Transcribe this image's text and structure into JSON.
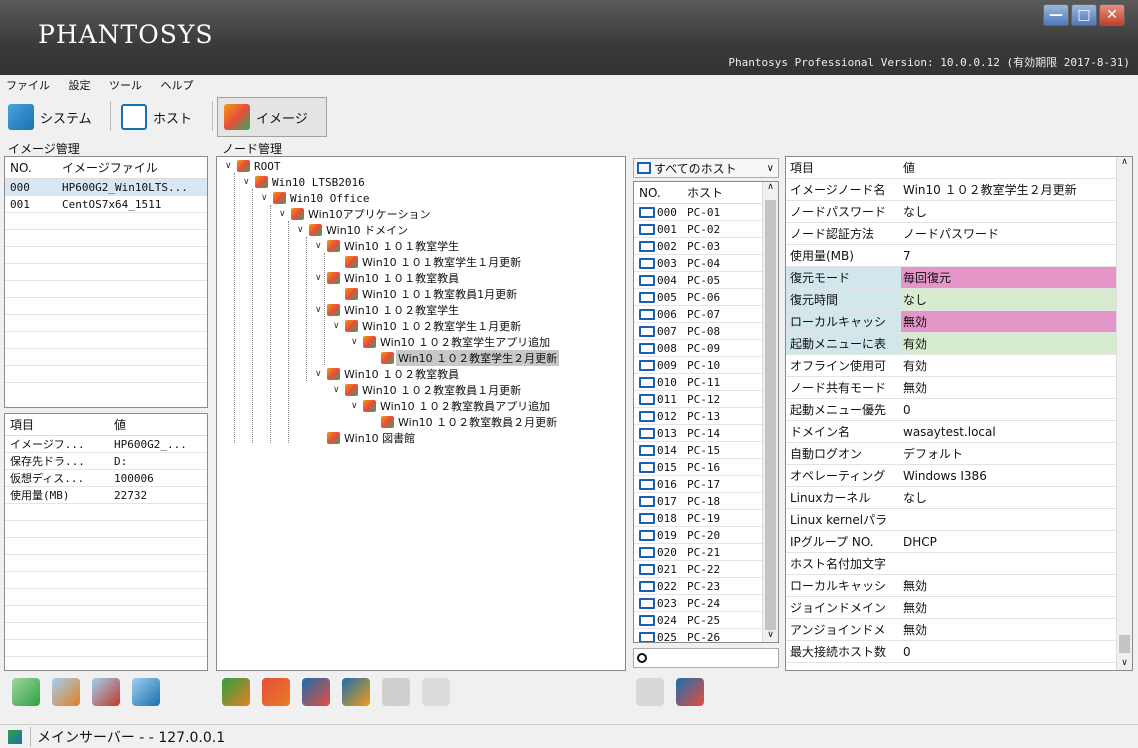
{
  "app": {
    "logo": "PHANTOSYS",
    "version": "Phantosys Professional Version: 10.0.0.12 (有効期限 2017-8-31)"
  },
  "window_controls": {
    "minimize": "—",
    "maximize": "□",
    "close": "✕"
  },
  "menu": [
    "ファイル",
    "設定",
    "ツール",
    "ヘルプ"
  ],
  "toolbar": {
    "system": "システム",
    "host": "ホスト",
    "image": "イメージ"
  },
  "image_mgmt": {
    "title": "イメージ管理",
    "col_no": "NO.",
    "col_file": "イメージファイル",
    "rows": [
      {
        "no": "000",
        "file": "HP600G2_Win10LTS..."
      },
      {
        "no": "001",
        "file": "CentOS7x64_1511"
      }
    ]
  },
  "image_props": {
    "col_key": "項目",
    "col_val": "値",
    "rows": [
      {
        "k": "イメージフ...",
        "v": "HP600G2_..."
      },
      {
        "k": "保存先ドラ...",
        "v": "D:"
      },
      {
        "k": "仮想ディス...",
        "v": "100006"
      },
      {
        "k": "使用量(MB)",
        "v": "22732"
      }
    ]
  },
  "node_mgmt": {
    "title": "ノード管理",
    "items": [
      {
        "label": "ROOT"
      },
      {
        "label": "Win10 LTSB2016"
      },
      {
        "label": "Win10 Office"
      },
      {
        "label": "Win10アプリケーション"
      },
      {
        "label": "Win10 ドメイン"
      },
      {
        "label": "Win10 １０１教室学生"
      },
      {
        "label": "Win10 １０１教室学生１月更新"
      },
      {
        "label": "Win10 １０１教室教員"
      },
      {
        "label": "Win10 １０１教室教員1月更新"
      },
      {
        "label": "Win10 １０２教室学生"
      },
      {
        "label": "Win10 １０２教室学生１月更新"
      },
      {
        "label": "Win10 １０２教室学生アプリ追加"
      },
      {
        "label": "Win10 １０２教室学生２月更新"
      },
      {
        "label": "Win10 １０２教室教員"
      },
      {
        "label": "Win10 １０２教室教員１月更新"
      },
      {
        "label": "Win10 １０２教室教員アプリ追加"
      },
      {
        "label": "Win10 １０２教室教員２月更新"
      },
      {
        "label": "Win10 図書館"
      }
    ]
  },
  "hosts": {
    "filter": "すべてのホスト",
    "col_no": "NO.",
    "col_host": "ホスト",
    "rows": [
      {
        "no": "000",
        "host": "PC-01"
      },
      {
        "no": "001",
        "host": "PC-02"
      },
      {
        "no": "002",
        "host": "PC-03"
      },
      {
        "no": "003",
        "host": "PC-04"
      },
      {
        "no": "004",
        "host": "PC-05"
      },
      {
        "no": "005",
        "host": "PC-06"
      },
      {
        "no": "006",
        "host": "PC-07"
      },
      {
        "no": "007",
        "host": "PC-08"
      },
      {
        "no": "008",
        "host": "PC-09"
      },
      {
        "no": "009",
        "host": "PC-10"
      },
      {
        "no": "010",
        "host": "PC-11"
      },
      {
        "no": "011",
        "host": "PC-12"
      },
      {
        "no": "012",
        "host": "PC-13"
      },
      {
        "no": "013",
        "host": "PC-14"
      },
      {
        "no": "014",
        "host": "PC-15"
      },
      {
        "no": "015",
        "host": "PC-16"
      },
      {
        "no": "016",
        "host": "PC-17"
      },
      {
        "no": "017",
        "host": "PC-18"
      },
      {
        "no": "018",
        "host": "PC-19"
      },
      {
        "no": "019",
        "host": "PC-20"
      },
      {
        "no": "020",
        "host": "PC-21"
      },
      {
        "no": "021",
        "host": "PC-22"
      },
      {
        "no": "022",
        "host": "PC-23"
      },
      {
        "no": "023",
        "host": "PC-24"
      },
      {
        "no": "024",
        "host": "PC-25"
      },
      {
        "no": "025",
        "host": "PC-26"
      }
    ]
  },
  "node_props": {
    "col_key": "項目",
    "col_val": "値",
    "rows": [
      {
        "k": "イメージノード名",
        "v": "Win10 １０２教室学生２月更新"
      },
      {
        "k": "ノードパスワード",
        "v": "なし"
      },
      {
        "k": "ノード認証方法",
        "v": "ノードパスワード"
      },
      {
        "k": "使用量(MB)",
        "v": "7"
      },
      {
        "k": "復元モード",
        "v": "毎回復元"
      },
      {
        "k": "復元時間",
        "v": "なし"
      },
      {
        "k": "ローカルキャッシ",
        "v": "無効"
      },
      {
        "k": "起動メニューに表",
        "v": "有効"
      },
      {
        "k": "オフライン使用可",
        "v": "有効"
      },
      {
        "k": "ノード共有モード",
        "v": "無効"
      },
      {
        "k": "起動メニュー優先",
        "v": "0"
      },
      {
        "k": "ドメイン名",
        "v": "wasaytest.local"
      },
      {
        "k": "自動ログオン",
        "v": "デフォルト"
      },
      {
        "k": "オペレーティング",
        "v": "Windows I386"
      },
      {
        "k": "Linuxカーネル",
        "v": "なし"
      },
      {
        "k": "Linux kernelパラ",
        "v": ""
      },
      {
        "k": "IPグループ NO.",
        "v": "DHCP"
      },
      {
        "k": "ホスト名付加文字",
        "v": ""
      },
      {
        "k": "ローカルキャッシ",
        "v": "無効"
      },
      {
        "k": "ジョインドメイン",
        "v": "無効"
      },
      {
        "k": "アンジョインドメ",
        "v": "無効"
      },
      {
        "k": "最大接続ホスト数",
        "v": "0"
      }
    ]
  },
  "status": {
    "text": "メインサーバー - - 127.0.0.1"
  }
}
